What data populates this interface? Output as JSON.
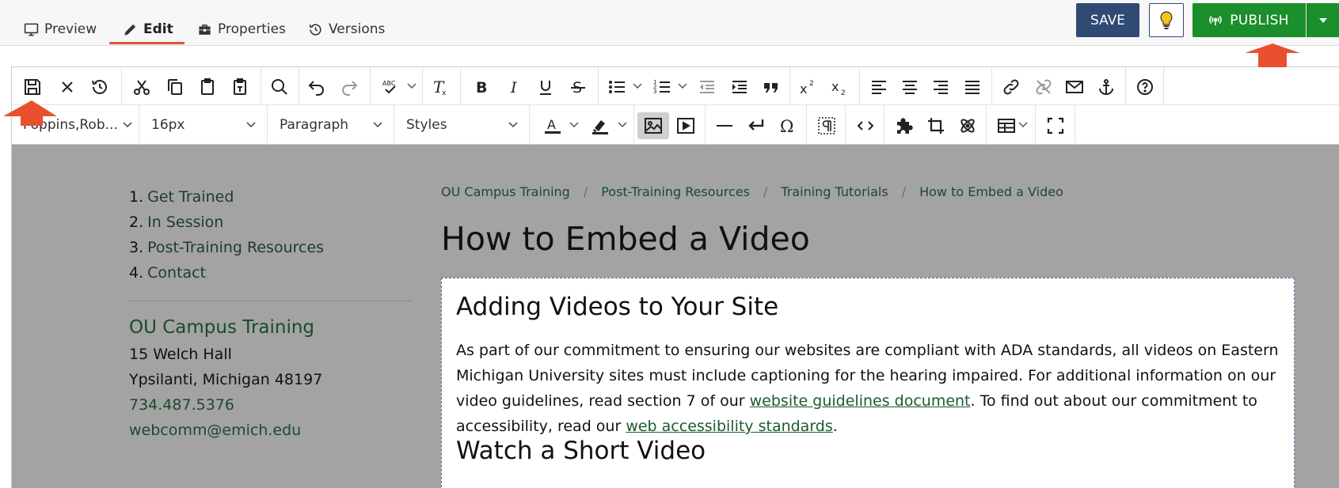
{
  "topbar": {
    "tabs": [
      {
        "label": "Preview",
        "icon": "monitor-icon"
      },
      {
        "label": "Edit",
        "icon": "pencil-icon",
        "active": true
      },
      {
        "label": "Properties",
        "icon": "toolbox-icon"
      },
      {
        "label": "Versions",
        "icon": "history-icon"
      }
    ],
    "save_label": "SAVE",
    "publish_label": "PUBLISH",
    "colors": {
      "save": "#2f4a73",
      "publish": "#1a8f2b",
      "active_tab_underline": "#e0553a",
      "annotation_arrow": "#e8502e"
    }
  },
  "toolbar": {
    "font_family": "Poppins,Rob...",
    "font_size": "16px",
    "block_format": "Paragraph",
    "styles": "Styles"
  },
  "sidebar": {
    "nav": [
      {
        "num": "1.",
        "label": "Get Trained"
      },
      {
        "num": "2.",
        "label": "In Session"
      },
      {
        "num": "3.",
        "label": "Post-Training Resources"
      },
      {
        "num": "4.",
        "label": "Contact"
      }
    ],
    "org_name": "OU Campus Training",
    "address_line1": "15 Welch Hall",
    "address_line2": "Ypsilanti, Michigan 48197",
    "phone": "734.487.5376",
    "email": "webcomm@emich.edu"
  },
  "main": {
    "breadcrumbs": [
      "OU Campus Training",
      "Post-Training Resources",
      "Training Tutorials",
      "How to Embed a Video"
    ],
    "title": "How to Embed a Video",
    "heading1": "Adding Videos to Your Site",
    "para_part1": "As part of our commitment to ensuring our websites are compliant with ADA standards, all videos on Eastern Michigan University sites must include captioning for the hearing impaired. For additional information on our video guidelines, read section 7 of our ",
    "link1": "website guidelines document",
    "para_part2": ". To find out about our commitment to accessibility, read our ",
    "link2": "web accessibility standards",
    "para_part3": ".",
    "heading2": "Watch a Short Video"
  }
}
